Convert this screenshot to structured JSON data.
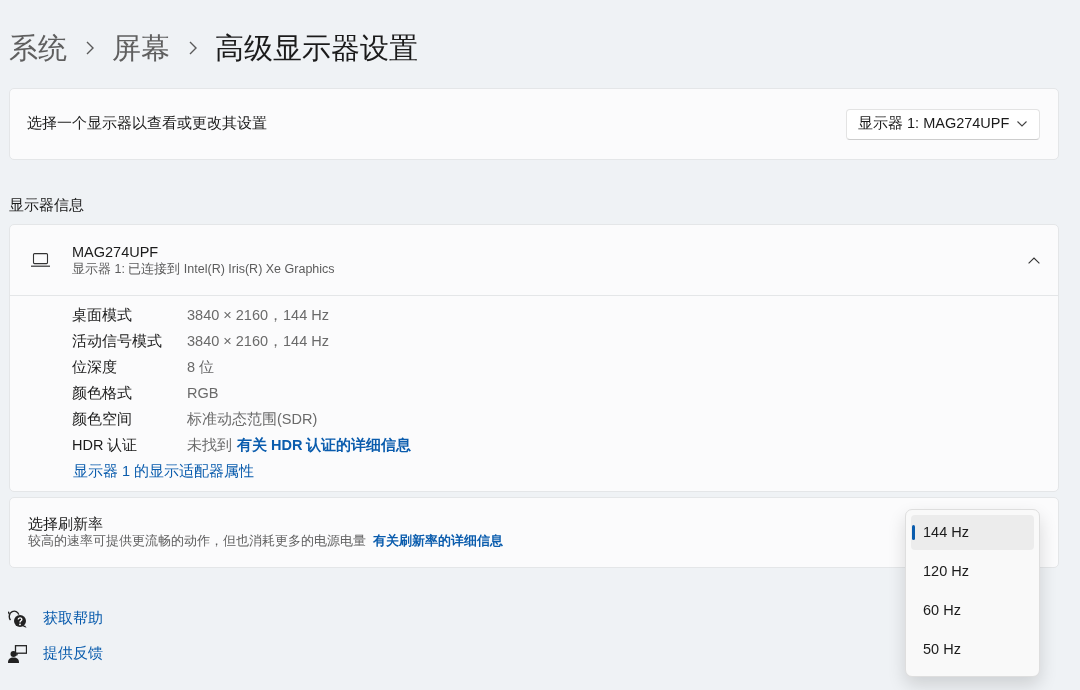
{
  "breadcrumb": {
    "path": [
      "系统",
      "屏幕"
    ],
    "current": "高级显示器设置"
  },
  "display_picker": {
    "label": "选择一个显示器以查看或更改其设置",
    "value": "显示器 1: MAG274UPF"
  },
  "display_info": {
    "heading": "显示器信息",
    "name": "MAG274UPF",
    "subtitle": "显示器 1: 已连接到 Intel(R) Iris(R) Xe Graphics",
    "expanded": true,
    "properties": [
      {
        "label": "桌面模式",
        "value": "3840 × 2160，144 Hz"
      },
      {
        "label": "活动信号模式",
        "value": "3840 × 2160，144 Hz"
      },
      {
        "label": "位深度",
        "value": "8 位"
      },
      {
        "label": "颜色格式",
        "value": "RGB"
      },
      {
        "label": "颜色空间",
        "value": "标准动态范围(SDR)"
      },
      {
        "label": "HDR 认证",
        "value": "未找到",
        "link": "有关 HDR 认证的详细信息"
      }
    ],
    "adapter_link": "显示器 1 的显示适配器属性"
  },
  "refresh_rate": {
    "title": "选择刷新率",
    "description": "较高的速率可提供更流畅的动作，但也消耗更多的电源电量",
    "link": "有关刷新率的详细信息",
    "options": [
      {
        "label": "144 Hz",
        "selected": true
      },
      {
        "label": "120 Hz",
        "selected": false
      },
      {
        "label": "60 Hz",
        "selected": false
      },
      {
        "label": "50 Hz",
        "selected": false
      }
    ]
  },
  "footer_links": [
    {
      "kind": "help",
      "label": "获取帮助"
    },
    {
      "kind": "feedback",
      "label": "提供反馈"
    }
  ]
}
